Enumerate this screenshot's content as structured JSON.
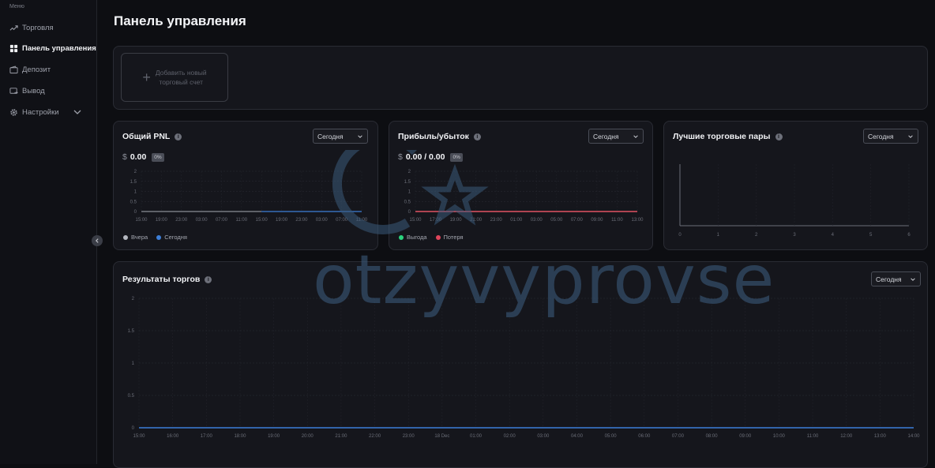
{
  "sidebar": {
    "menu_label": "Меню",
    "items": [
      {
        "label": "Торговля",
        "icon": "trending-up-icon"
      },
      {
        "label": "Панель управления",
        "icon": "dashboard-grid-icon"
      },
      {
        "label": "Депозит",
        "icon": "wallet-icon"
      },
      {
        "label": "Вывод",
        "icon": "withdraw-icon"
      },
      {
        "label": "Настройки",
        "icon": "gear-icon"
      }
    ],
    "active_index": 1
  },
  "page": {
    "title": "Панель управления"
  },
  "accounts": {
    "add_label_line1": "Добавить новый",
    "add_label_line2": "торговый счет"
  },
  "pnl_card": {
    "title": "Общий PNL",
    "period": "Сегодня",
    "currency": "$",
    "value": "0.00",
    "badge": "0%",
    "legend": [
      "Вчера",
      "Сегодня"
    ]
  },
  "profit_card": {
    "title": "Прибыль/убыток",
    "period": "Сегодня",
    "currency": "$",
    "value": "0.00 / 0.00",
    "badge": "0%",
    "legend": [
      "Выгода",
      "Потеря"
    ]
  },
  "pairs_card": {
    "title": "Лучшие торговые пары",
    "period": "Сегодня"
  },
  "results_card": {
    "title": "Результаты торгов",
    "period": "Сегодня"
  },
  "watermark": {
    "text": "otzyvyprovse"
  },
  "colors": {
    "accent_blue": "#3d7fd9",
    "loss_red": "#e0455b",
    "gain_green": "#2bd37d",
    "yesterday_gray": "#b5b8c0"
  },
  "chart_data": [
    {
      "type": "line",
      "title": "Общий PNL",
      "x": [
        "15:00",
        "19:00",
        "23:00",
        "03:00",
        "07:00",
        "11:00",
        "15:00",
        "19:00",
        "23:00",
        "03:00",
        "07:00",
        "11:00"
      ],
      "ylim": [
        0,
        2
      ],
      "yticks": [
        "2",
        "1.5",
        "1",
        "0.5",
        "0"
      ],
      "series": [
        {
          "name": "Вчера",
          "values": [
            0,
            0,
            0,
            0,
            0,
            0,
            0
          ]
        },
        {
          "name": "Сегодня",
          "values": [
            0,
            0,
            0,
            0,
            0,
            0
          ]
        }
      ]
    },
    {
      "type": "line",
      "title": "Прибыль/убыток",
      "x": [
        "15:00",
        "17:00",
        "19:00",
        "21:00",
        "23:00",
        "01:00",
        "03:00",
        "05:00",
        "07:00",
        "09:00",
        "11:00",
        "13:00"
      ],
      "ylim": [
        0,
        2
      ],
      "yticks": [
        "2",
        "1.5",
        "1",
        "0.5",
        "0"
      ],
      "series": [
        {
          "name": "Выгода",
          "values": [
            0,
            0,
            0,
            0,
            0,
            0,
            0,
            0,
            0,
            0,
            0,
            0
          ]
        },
        {
          "name": "Потеря",
          "values": [
            0,
            0,
            0,
            0,
            0,
            0,
            0,
            0,
            0,
            0,
            0,
            0
          ]
        }
      ]
    },
    {
      "type": "bar",
      "title": "Лучшие торговые пары",
      "x": [
        "0",
        "1",
        "2",
        "3",
        "4",
        "5",
        "6"
      ],
      "values": []
    },
    {
      "type": "line",
      "title": "Результаты торгов",
      "x": [
        "15:00",
        "16:00",
        "17:00",
        "18:00",
        "19:00",
        "20:00",
        "21:00",
        "22:00",
        "23:00",
        "18 Dec",
        "01:00",
        "02:00",
        "03:00",
        "04:00",
        "05:00",
        "06:00",
        "07:00",
        "08:00",
        "09:00",
        "10:00",
        "11:00",
        "12:00",
        "13:00",
        "14:00"
      ],
      "ylim": [
        0,
        2
      ],
      "yticks": [
        "2",
        "1.5",
        "1",
        "0.5",
        "0"
      ],
      "series": [
        {
          "values": [
            0,
            0,
            0,
            0,
            0,
            0,
            0,
            0,
            0,
            0,
            0,
            0,
            0,
            0,
            0,
            0,
            0,
            0,
            0,
            0,
            0,
            0,
            0,
            0
          ]
        }
      ]
    }
  ]
}
